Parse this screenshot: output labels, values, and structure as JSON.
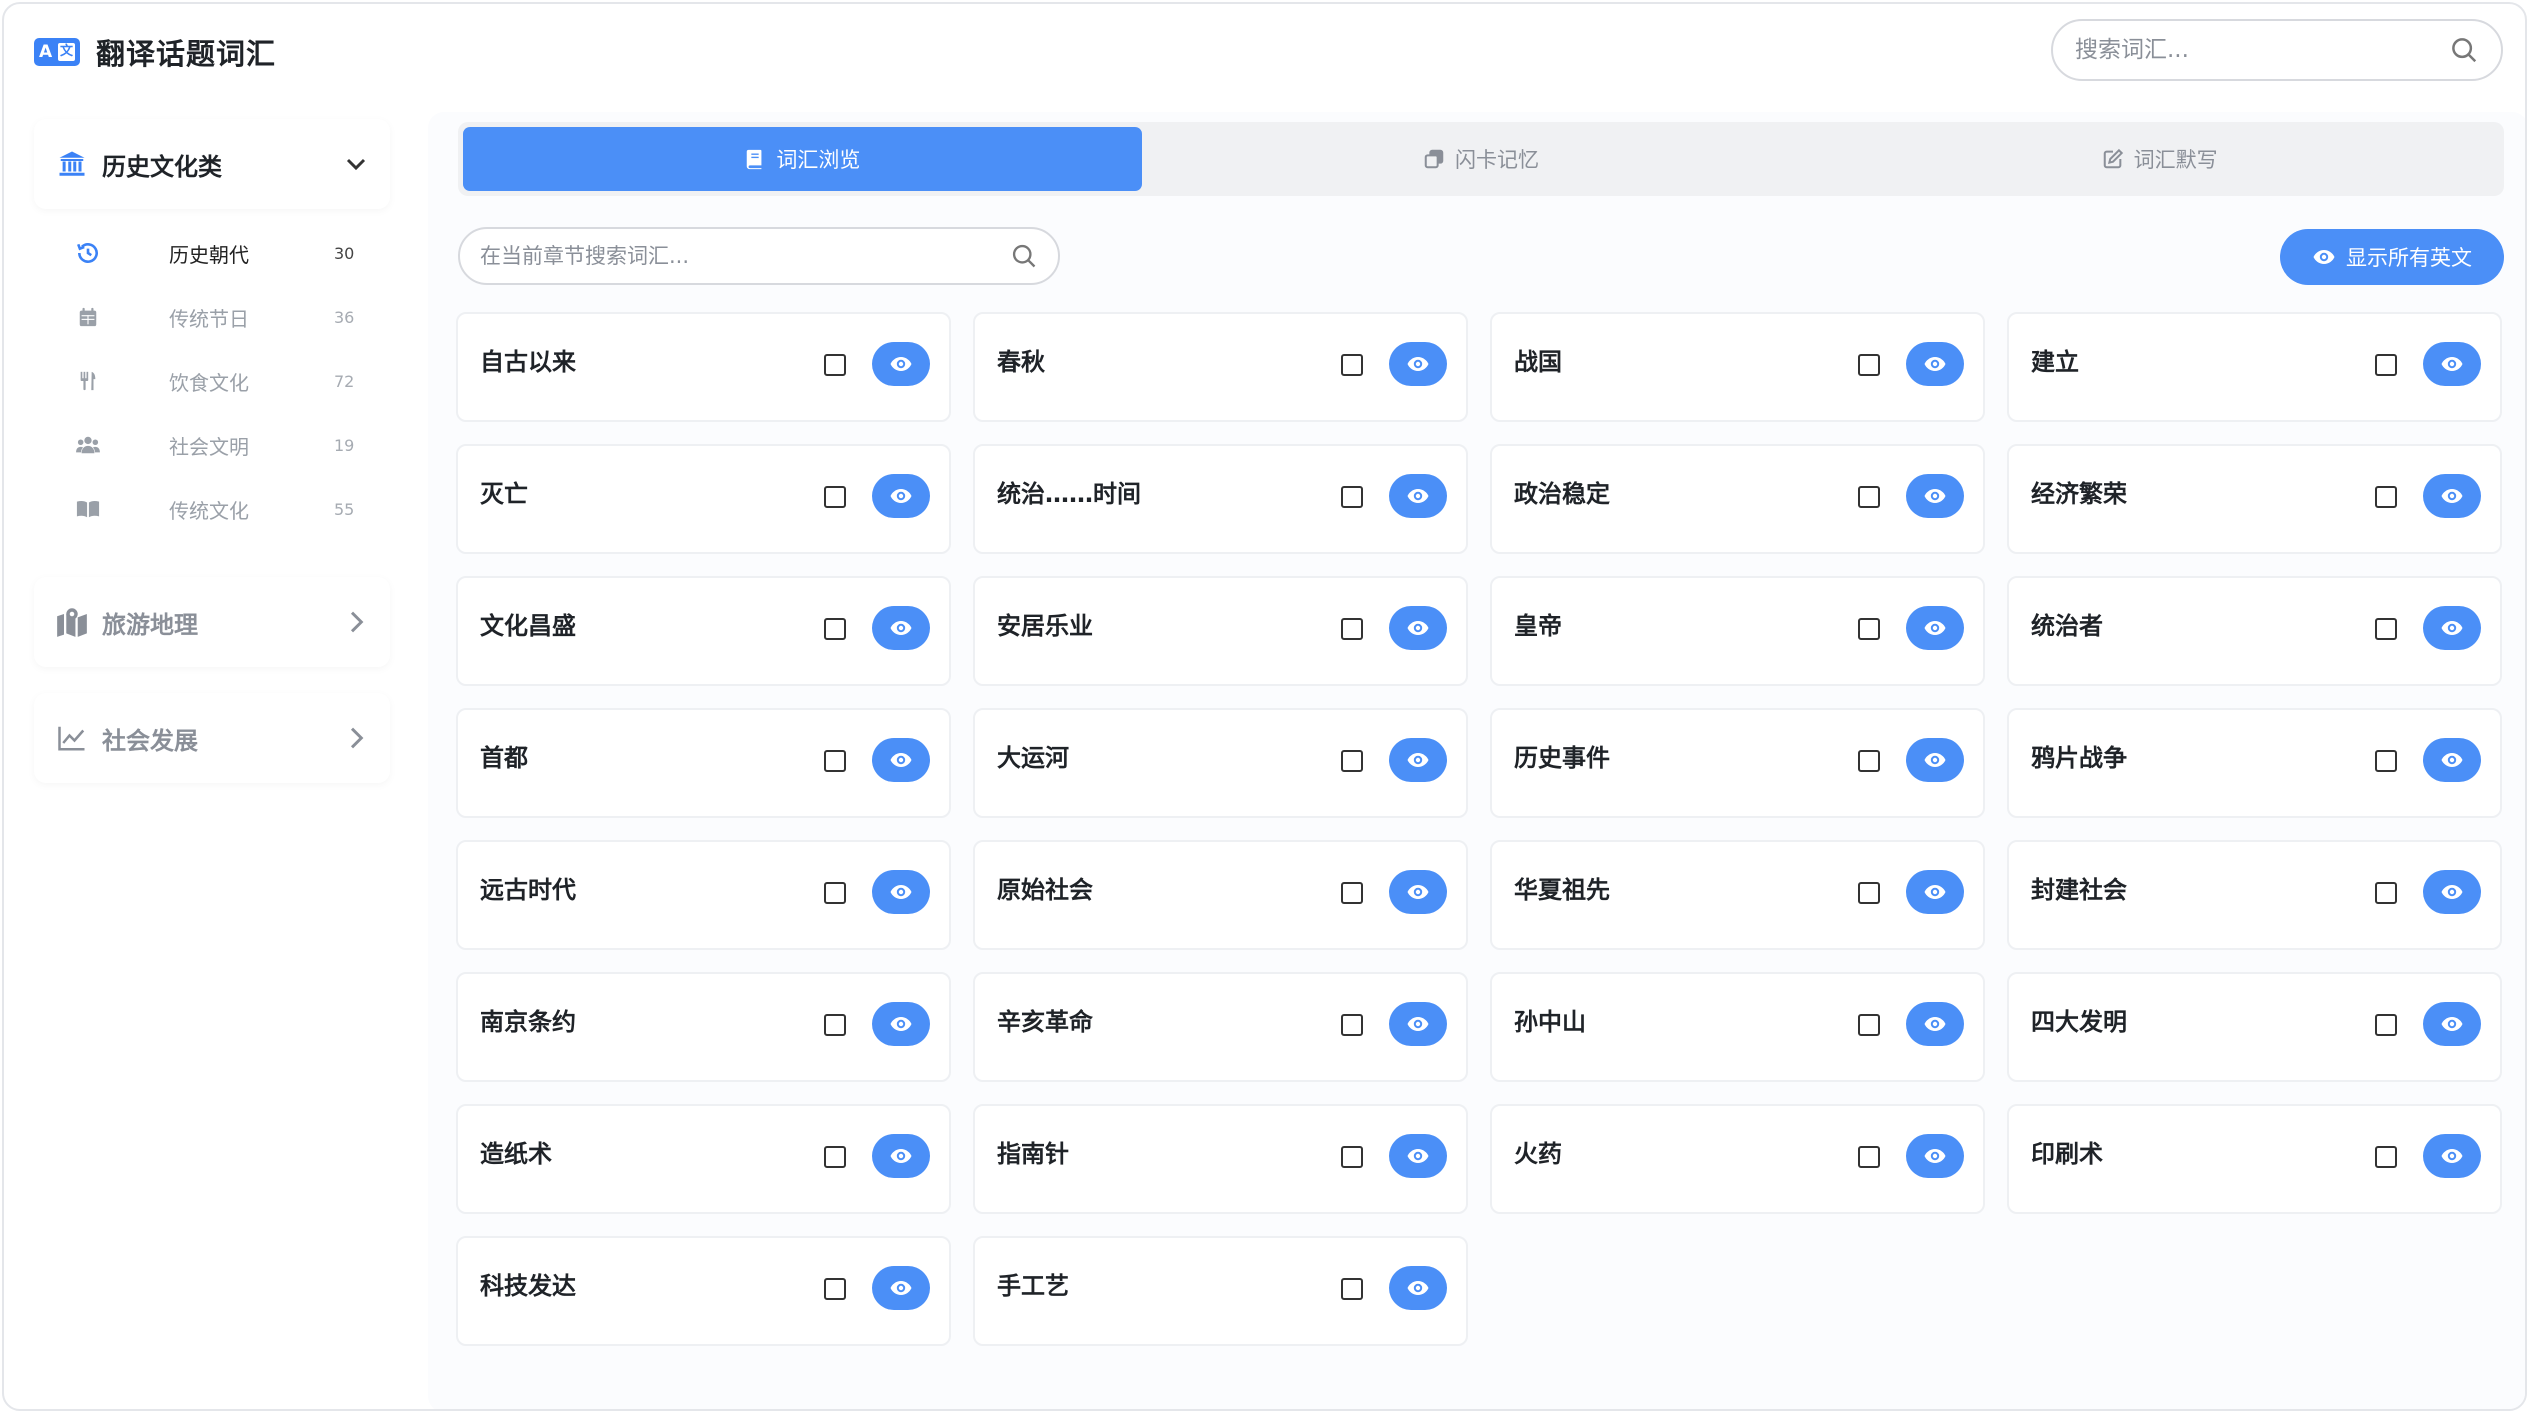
{
  "app": {
    "title": "翻译话题词汇",
    "logo_left": "A",
    "logo_right": "文"
  },
  "top_search": {
    "placeholder": "搜索词汇..."
  },
  "sidebar": {
    "categories": [
      {
        "label": "历史文化类",
        "icon": "bank-icon",
        "expanded": true
      },
      {
        "label": "旅游地理",
        "icon": "map-icon",
        "expanded": false
      },
      {
        "label": "社会发展",
        "icon": "chart-line-icon",
        "expanded": false
      }
    ],
    "sections": [
      {
        "label": "历史朝代",
        "count": "30",
        "icon": "history-icon",
        "active": true
      },
      {
        "label": "传统节日",
        "count": "36",
        "icon": "calendar-icon",
        "active": false
      },
      {
        "label": "饮食文化",
        "count": "72",
        "icon": "utensils-icon",
        "active": false
      },
      {
        "label": "社会文明",
        "count": "19",
        "icon": "users-icon",
        "active": false
      },
      {
        "label": "传统文化",
        "count": "55",
        "icon": "book-icon",
        "active": false
      }
    ]
  },
  "tabs": [
    {
      "label": "词汇浏览",
      "icon": "book-icon",
      "active": true
    },
    {
      "label": "闪卡记忆",
      "icon": "cards-icon",
      "active": false
    },
    {
      "label": "词汇默写",
      "icon": "edit-icon",
      "active": false
    }
  ],
  "chapter_search": {
    "placeholder": "在当前章节搜索词汇..."
  },
  "show_all_button": {
    "label": "显示所有英文"
  },
  "words": [
    "自古以来",
    "春秋",
    "战国",
    "建立",
    "灭亡",
    "统治……时间",
    "政治稳定",
    "经济繁荣",
    "文化昌盛",
    "安居乐业",
    "皇帝",
    "统治者",
    "首都",
    "大运河",
    "历史事件",
    "鸦片战争",
    "远古时代",
    "原始社会",
    "华夏祖先",
    "封建社会",
    "南京条约",
    "辛亥革命",
    "孙中山",
    "四大发明",
    "造纸术",
    "指南针",
    "火药",
    "印刷术",
    "科技发达",
    "手工艺"
  ],
  "colors": {
    "accent": "#4b8ff7",
    "brand": "#3b82f6"
  }
}
